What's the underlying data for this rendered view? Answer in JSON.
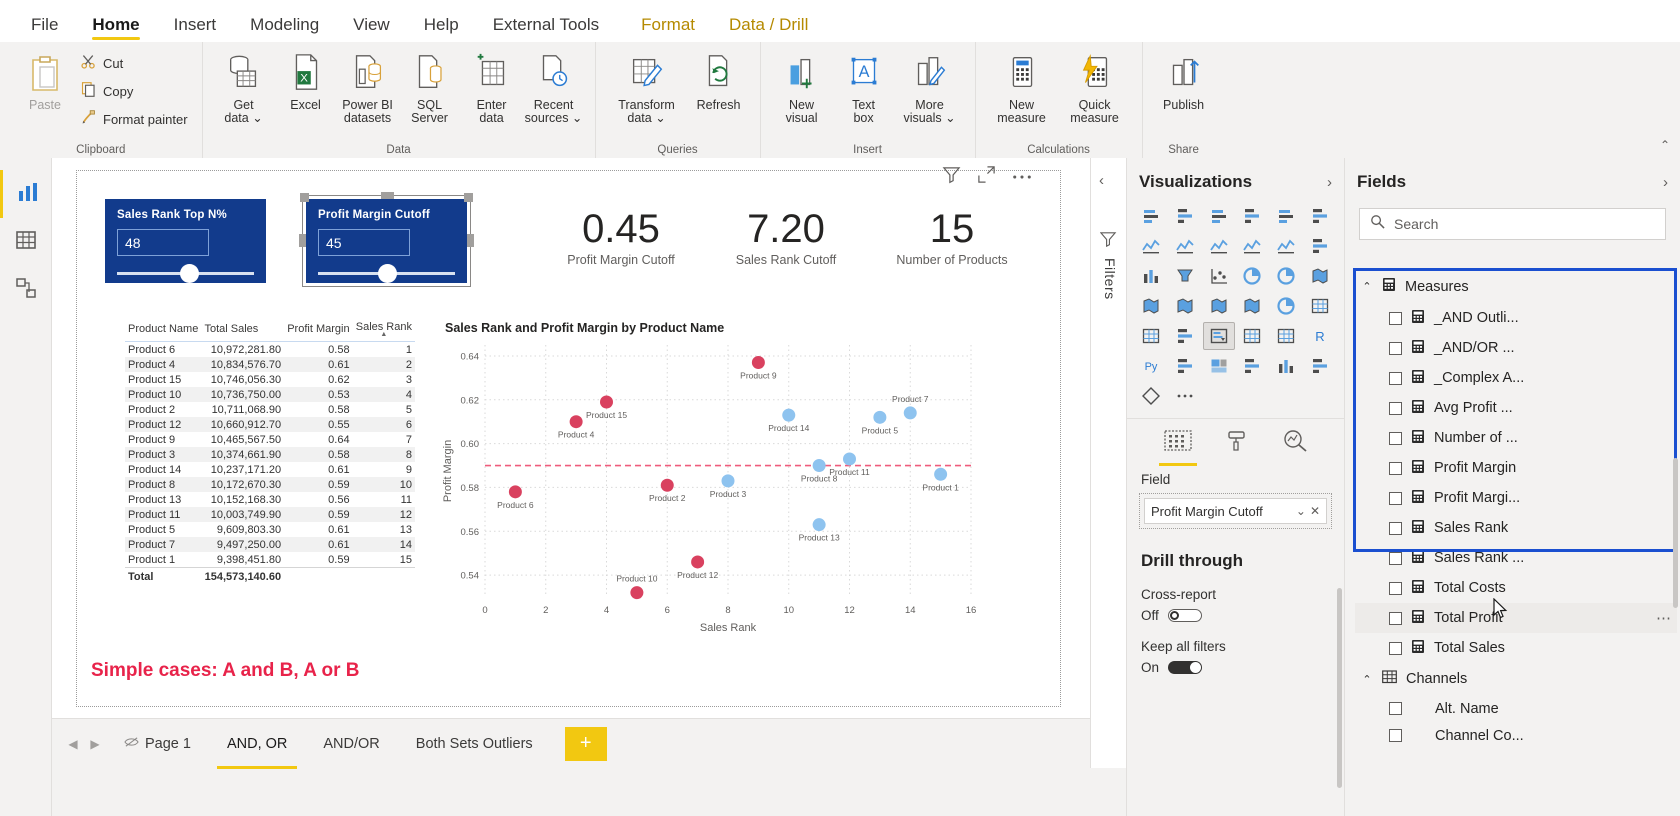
{
  "ribbon": {
    "tabs": [
      {
        "label": "File",
        "active": false
      },
      {
        "label": "Home",
        "active": true
      },
      {
        "label": "Insert",
        "active": false
      },
      {
        "label": "Modeling",
        "active": false
      },
      {
        "label": "View",
        "active": false
      },
      {
        "label": "Help",
        "active": false
      },
      {
        "label": "External Tools",
        "active": false
      }
    ],
    "contextual_tabs": [
      {
        "label": "Format"
      },
      {
        "label": "Data / Drill"
      }
    ],
    "groups": [
      {
        "name": "Clipboard",
        "big": [
          {
            "label": "Paste",
            "icon": "paste-icon",
            "disabled": true
          }
        ],
        "small": [
          {
            "label": "Cut",
            "icon": "scissors-icon"
          },
          {
            "label": "Copy",
            "icon": "copy-icon"
          },
          {
            "label": "Format painter",
            "icon": "paintbrush-icon"
          }
        ]
      },
      {
        "name": "Data",
        "big": [
          {
            "label": "Get\ndata",
            "line1": "Get",
            "line2": "data",
            "icon": "get-data-icon",
            "caret": true
          },
          {
            "label": "Excel",
            "line1": "Excel",
            "line2": "",
            "icon": "excel-icon",
            "caret": false
          },
          {
            "label": "Power BI datasets",
            "line1": "Power BI",
            "line2": "datasets",
            "icon": "powerbi-datasets-icon",
            "caret": false
          },
          {
            "label": "SQL Server",
            "line1": "SQL",
            "line2": "Server",
            "icon": "sql-server-icon",
            "caret": false
          },
          {
            "label": "Enter data",
            "line1": "Enter",
            "line2": "data",
            "icon": "enter-data-icon",
            "caret": false
          },
          {
            "label": "Recent sources",
            "line1": "Recent",
            "line2": "sources",
            "icon": "recent-sources-icon",
            "caret": true
          }
        ]
      },
      {
        "name": "Queries",
        "big": [
          {
            "label": "Transform data",
            "line1": "Transform",
            "line2": "data",
            "icon": "transform-data-icon",
            "caret": true
          },
          {
            "label": "Refresh",
            "line1": "Refresh",
            "line2": "",
            "icon": "refresh-icon",
            "caret": false
          }
        ]
      },
      {
        "name": "Insert",
        "big": [
          {
            "label": "New visual",
            "line1": "New",
            "line2": "visual",
            "icon": "new-visual-icon",
            "caret": false
          },
          {
            "label": "Text box",
            "line1": "Text",
            "line2": "box",
            "icon": "text-box-icon",
            "caret": false
          },
          {
            "label": "More visuals",
            "line1": "More",
            "line2": "visuals",
            "icon": "more-visuals-icon",
            "caret": true
          }
        ]
      },
      {
        "name": "Calculations",
        "big": [
          {
            "label": "New measure",
            "line1": "New",
            "line2": "measure",
            "icon": "new-measure-icon",
            "caret": false
          },
          {
            "label": "Quick measure",
            "line1": "Quick",
            "line2": "measure",
            "icon": "quick-measure-icon",
            "caret": false
          }
        ]
      },
      {
        "name": "Share",
        "big": [
          {
            "label": "Publish",
            "line1": "Publish",
            "line2": "",
            "icon": "publish-icon",
            "caret": false
          }
        ]
      }
    ]
  },
  "left_rail": [
    {
      "name": "report-view",
      "icon": "report-chart-icon",
      "active": true
    },
    {
      "name": "data-view",
      "icon": "table-grid-icon",
      "active": false
    },
    {
      "name": "model-view",
      "icon": "model-relationship-icon",
      "active": false
    }
  ],
  "report": {
    "slicers": [
      {
        "title": "Sales Rank Top N%",
        "value": "48",
        "knob_pct": 50,
        "selected": false
      },
      {
        "title": "Profit Margin Cutoff",
        "value": "45",
        "knob_pct": 47,
        "selected": true
      }
    ],
    "kpis": [
      {
        "value": "0.45",
        "label": "Profit Margin Cutoff"
      },
      {
        "value": "7.20",
        "label": "Sales Rank Cutoff"
      },
      {
        "value": "15",
        "label": "Number of Products"
      }
    ],
    "caption": "Simple cases: A and B, A or B",
    "table": {
      "columns": [
        "Product Name",
        "Total Sales",
        "Profit Margin",
        "Sales Rank"
      ],
      "sorted_column": "Sales Rank",
      "rows": [
        [
          "Product 6",
          "10,972,281.80",
          "0.58",
          "1"
        ],
        [
          "Product 4",
          "10,834,576.70",
          "0.61",
          "2"
        ],
        [
          "Product 15",
          "10,746,056.30",
          "0.62",
          "3"
        ],
        [
          "Product 10",
          "10,736,750.00",
          "0.53",
          "4"
        ],
        [
          "Product 2",
          "10,711,068.90",
          "0.58",
          "5"
        ],
        [
          "Product 12",
          "10,660,912.70",
          "0.55",
          "6"
        ],
        [
          "Product 9",
          "10,465,567.50",
          "0.64",
          "7"
        ],
        [
          "Product 3",
          "10,374,661.90",
          "0.58",
          "8"
        ],
        [
          "Product 14",
          "10,237,171.20",
          "0.61",
          "9"
        ],
        [
          "Product 8",
          "10,172,670.30",
          "0.59",
          "10"
        ],
        [
          "Product 13",
          "10,152,168.30",
          "0.56",
          "11"
        ],
        [
          "Product 11",
          "10,003,749.90",
          "0.59",
          "12"
        ],
        [
          "Product 5",
          "9,609,803.30",
          "0.61",
          "13"
        ],
        [
          "Product 7",
          "9,497,250.00",
          "0.61",
          "14"
        ],
        [
          "Product 1",
          "9,398,451.80",
          "0.59",
          "15"
        ]
      ],
      "total": [
        "Total",
        "154,573,140.60",
        "",
        ""
      ]
    }
  },
  "chart_data": {
    "type": "scatter",
    "title": "Sales Rank and Profit Margin by Product Name",
    "xlabel": "Sales Rank",
    "ylabel": "Profit Margin",
    "xlim": [
      0,
      16
    ],
    "ylim": [
      0.53,
      0.645
    ],
    "xticks": [
      "0",
      "2",
      "4",
      "6",
      "8",
      "10",
      "12",
      "14",
      "16"
    ],
    "yticks": [
      "0.54",
      "0.56",
      "0.58",
      "0.60",
      "0.62",
      "0.64"
    ],
    "grid": true,
    "legend": "none",
    "reference_line": {
      "axis": "y",
      "value": 0.59,
      "color": "#ef5c7c",
      "style": "dashed"
    },
    "colors": {
      "highlight": "#d9415f",
      "normal": "#8ec3ef"
    },
    "points": [
      {
        "label": "Product 6",
        "x": 1,
        "y": 0.578,
        "color": "highlight",
        "lblpos": "below"
      },
      {
        "label": "Product 4",
        "x": 3,
        "y": 0.61,
        "color": "highlight",
        "lblpos": "below"
      },
      {
        "label": "Product 15",
        "x": 4,
        "y": 0.619,
        "color": "highlight",
        "lblpos": "below"
      },
      {
        "label": "Product 10",
        "x": 5,
        "y": 0.532,
        "color": "highlight",
        "lblpos": "above"
      },
      {
        "label": "Product 2",
        "x": 6,
        "y": 0.581,
        "color": "highlight",
        "lblpos": "below"
      },
      {
        "label": "Product 12",
        "x": 7,
        "y": 0.546,
        "color": "highlight",
        "lblpos": "below"
      },
      {
        "label": "Product 9",
        "x": 9,
        "y": 0.637,
        "color": "highlight",
        "lblpos": "below"
      },
      {
        "label": "Product 3",
        "x": 8,
        "y": 0.583,
        "color": "normal",
        "lblpos": "below"
      },
      {
        "label": "Product 14",
        "x": 10,
        "y": 0.613,
        "color": "normal",
        "lblpos": "below"
      },
      {
        "label": "Product 8",
        "x": 11,
        "y": 0.59,
        "color": "normal",
        "lblpos": "below"
      },
      {
        "label": "Product 13",
        "x": 11,
        "y": 0.563,
        "color": "normal",
        "lblpos": "below"
      },
      {
        "label": "Product 11",
        "x": 12,
        "y": 0.593,
        "color": "normal",
        "lblpos": "below"
      },
      {
        "label": "Product 5",
        "x": 13,
        "y": 0.612,
        "color": "normal",
        "lblpos": "below"
      },
      {
        "label": "Product 7",
        "x": 14,
        "y": 0.614,
        "color": "normal",
        "lblpos": "above"
      },
      {
        "label": "Product 1",
        "x": 15,
        "y": 0.586,
        "color": "normal",
        "lblpos": "below"
      }
    ]
  },
  "page_tabs": [
    {
      "label": "Page 1",
      "active": false,
      "hidden": true
    },
    {
      "label": "AND, OR",
      "active": true,
      "hidden": false
    },
    {
      "label": "AND/OR",
      "active": false,
      "hidden": false
    },
    {
      "label": "Both Sets Outliers",
      "active": false,
      "hidden": false
    }
  ],
  "add_page_label": "+",
  "filters": {
    "label": "Filters"
  },
  "visualizations": {
    "title": "Visualizations",
    "icons": [
      "stacked-bar-chart-icon",
      "stacked-column-chart-icon",
      "clustered-bar-chart-icon",
      "clustered-column-chart-icon",
      "100-stacked-bar-icon",
      "100-stacked-column-icon",
      "line-chart-icon",
      "area-chart-icon",
      "stacked-area-icon",
      "line-stacked-column-icon",
      "line-clustered-column-icon",
      "ribbon-chart-icon",
      "waterfall-chart-icon",
      "funnel-chart-icon",
      "scatter-chart-icon",
      "pie-chart-icon",
      "donut-chart-icon",
      "treemap-icon",
      "map-icon",
      "filled-map-icon",
      "shape-map-icon",
      "azure-map-icon",
      "gauge-icon",
      "card-icon",
      "multi-row-card-icon",
      "kpi-icon",
      "slicer-icon",
      "table-icon",
      "matrix-icon",
      "r-script-visual-icon",
      "python-visual-icon",
      "key-influencers-icon",
      "decomposition-tree-icon",
      "qa-visual-icon",
      "smart-narrative-icon",
      "paginated-report-icon",
      "more-shapes-icon",
      "more-options-icon"
    ],
    "selected_icon_index": 26,
    "format_tabs": [
      {
        "name": "fields-tab",
        "active": true
      },
      {
        "name": "format-paintroller-tab",
        "active": false
      },
      {
        "name": "analytics-tab",
        "active": false
      }
    ],
    "field_well_label": "Field",
    "field_chip": "Profit Margin Cutoff",
    "drill_through": {
      "title": "Drill through",
      "cross_report_label": "Cross-report",
      "cross_report_state": "Off",
      "keep_all_filters_label": "Keep all filters",
      "keep_all_filters_state": "On"
    }
  },
  "fields": {
    "title": "Fields",
    "search_placeholder": "Search",
    "groups": [
      {
        "name": "Measures",
        "icon": "measure-table-icon",
        "expanded": true,
        "items": [
          "_AND Outli...",
          "_AND/OR ...",
          "_Complex A...",
          "Avg Profit ...",
          "Number of ...",
          "Profit Margin",
          "Profit Margi...",
          "Sales Rank",
          "Sales Rank ...",
          "Total Costs",
          "Total Profit",
          "Total Sales"
        ]
      },
      {
        "name": "Channels",
        "icon": "table-icon",
        "expanded": true,
        "items": [
          "Alt. Name",
          "Channel Co..."
        ]
      }
    ],
    "hovered_item": "Total Profit"
  }
}
